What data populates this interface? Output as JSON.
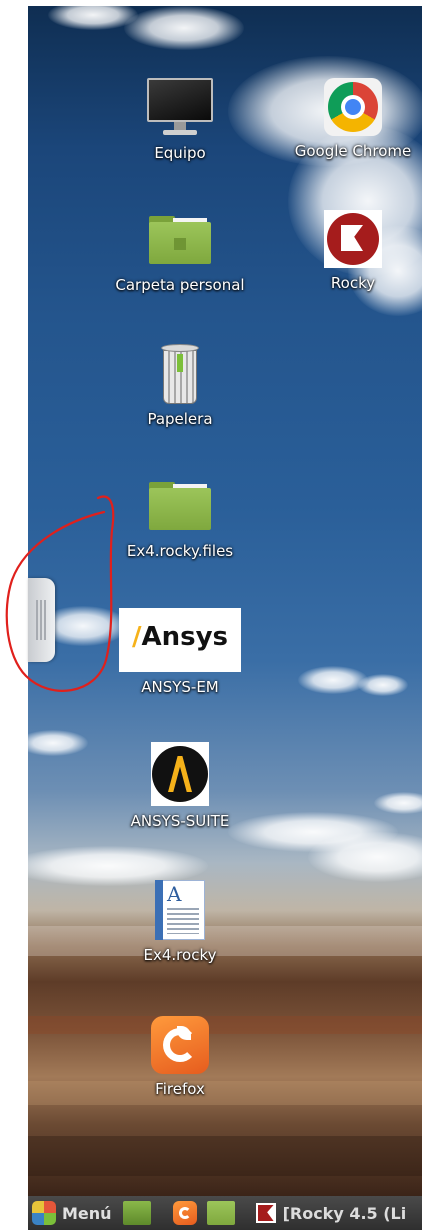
{
  "desktop": {
    "icons": [
      {
        "label": "Equipo",
        "icon": "computer-icon"
      },
      {
        "label": "Google Chrome",
        "icon": "chrome-icon"
      },
      {
        "label": "Carpeta personal",
        "icon": "home-folder-icon"
      },
      {
        "label": "Rocky",
        "icon": "rocky-icon"
      },
      {
        "label": "Papelera",
        "icon": "trash-icon"
      },
      {
        "label": "Ex4.rocky.files",
        "icon": "folder-icon"
      },
      {
        "label": "ANSYS-EM",
        "icon": "ansys-em-icon",
        "logo_text": "Ansys"
      },
      {
        "label": "ANSYS-SUITE",
        "icon": "ansys-suite-icon"
      },
      {
        "label": "Ex4.rocky",
        "icon": "document-icon",
        "glyph": "A"
      },
      {
        "label": "Firefox",
        "icon": "firefox-icon"
      }
    ],
    "annotation_color": "#e0201c"
  },
  "taskbar": {
    "menu_label": "Menú",
    "launchers": [
      "show-desktop-icon",
      "firefox-icon",
      "folder-icon"
    ],
    "window_label": "[Rocky 4.5 (Li"
  }
}
